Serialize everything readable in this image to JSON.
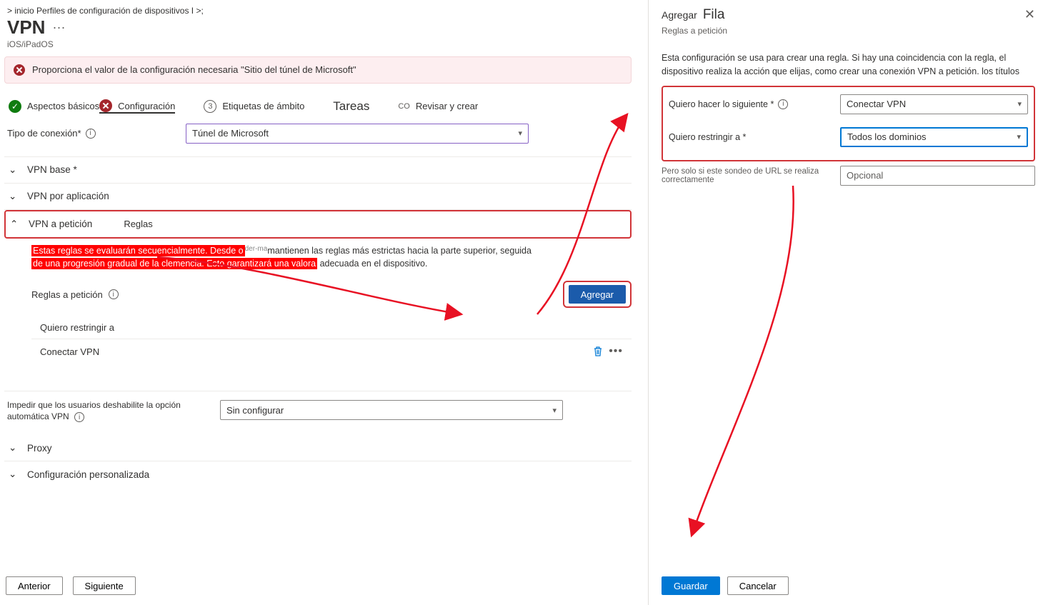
{
  "breadcrumb": "> inicio   Perfiles de configuración de dispositivos I >;",
  "page_title": "VPN",
  "subtitle": "iOS/iPadOS",
  "alert": "Proporciona el valor de la configuración necesaria \"Sitio del túnel de Microsoft\"",
  "wizard": {
    "step1": "Aspectos básicos",
    "step2": "Configuración",
    "step3_num": "3",
    "step3": "Etiquetas de ámbito",
    "step4_pre": "",
    "step4": "Tareas",
    "step5_pre": "CO",
    "step5": "Revisar y crear"
  },
  "connection": {
    "label": "Tipo de conexión*",
    "value": "Túnel de Microsoft"
  },
  "sections": {
    "base": "VPN base *",
    "perapp": "VPN por aplicación",
    "ondemand": "VPN a petición",
    "ondemand_sub": "Reglas",
    "proxy": "Proxy",
    "custom": "Configuración personalizada"
  },
  "ondemand_desc": {
    "hl1": "Estas reglas se evaluarán secuencialmente. Desde o",
    "mid1": "mantienen las reglas más estrictas hacia la parte superior, seguida",
    "hl2": "de una progresión gradual de la clemencia. Esto garantizará una valora",
    "mid2": "adecuada en el dispositivo.",
    "tiny": "der-ma"
  },
  "rules": {
    "label": "Reglas a petición",
    "add": "Agregar",
    "header": "Quiero restringir a",
    "item1": "Conectar VPN"
  },
  "prevent": {
    "label": "Impedir que los usuarios deshabilite la opción automática VPN",
    "value": "Sin configurar"
  },
  "footer": {
    "prev": "Anterior",
    "next": "Siguiente"
  },
  "panel": {
    "title_pre": "Agregar",
    "title_big": "Fila",
    "sub": "Reglas a petición",
    "desc": "Esta configuración se usa para crear una regla. Si hay una coincidencia con la regla, el dispositivo realiza la acción que elijas, como crear una conexión VPN a petición. los títulos",
    "f1_label": "Quiero hacer lo siguiente *",
    "f1_value": "Conectar VPN",
    "f2_label": "Quiero restringir a *",
    "f2_value": "Todos los dominios",
    "hint_label": "Pero solo si este sondeo de URL se realiza correctamente",
    "hint_value": "Opcional",
    "save": "Guardar",
    "cancel": "Cancelar"
  }
}
